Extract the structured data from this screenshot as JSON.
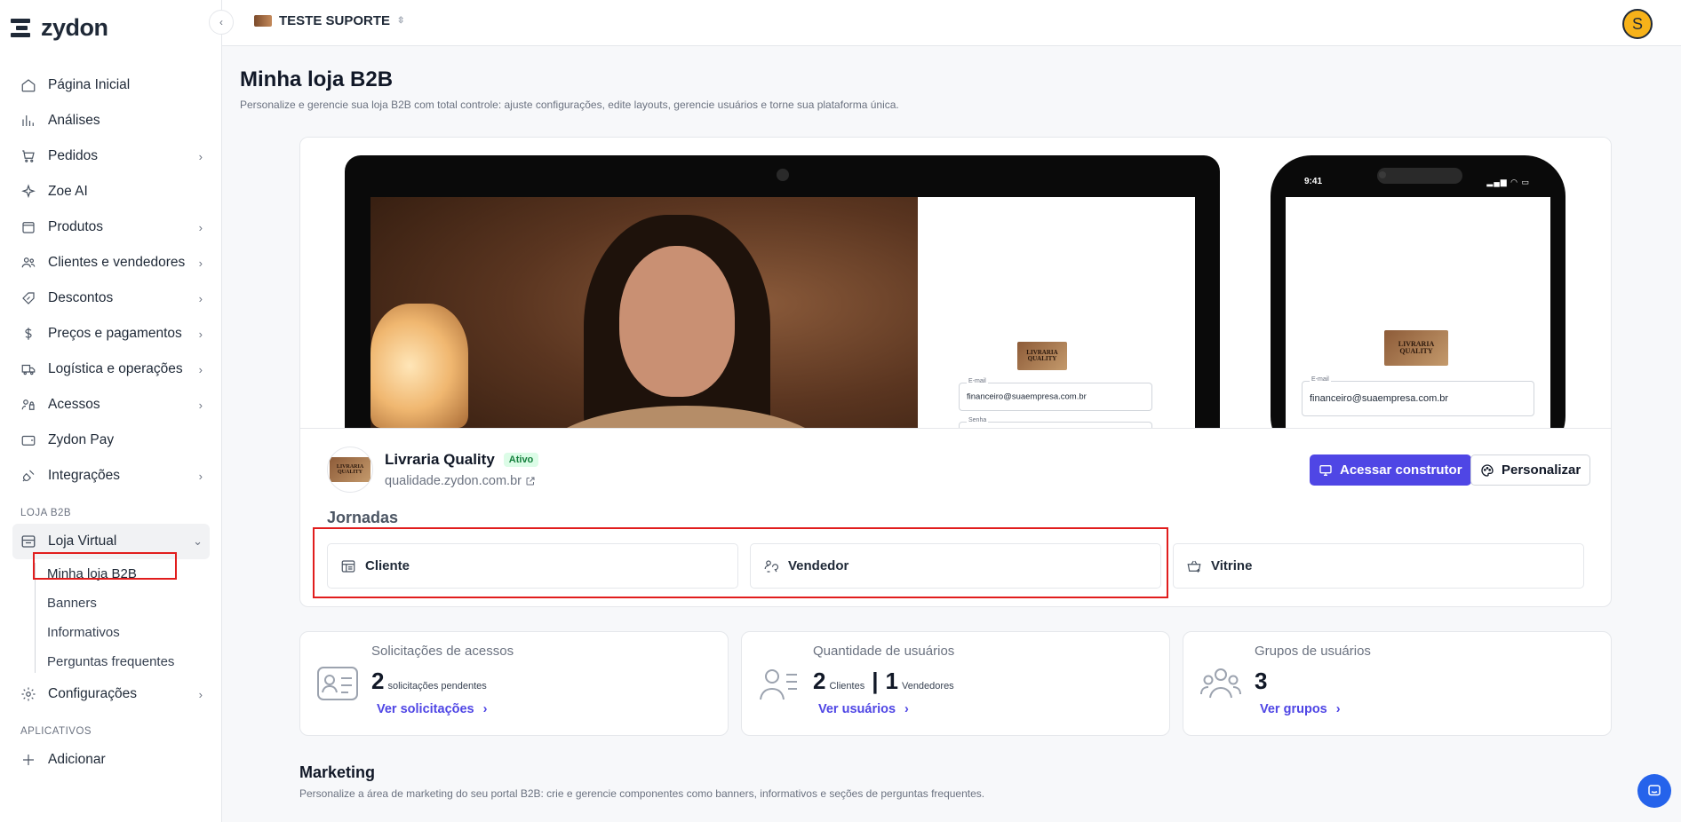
{
  "brand": {
    "name": "zydon"
  },
  "sidebar": {
    "items": [
      {
        "label": "Página Inicial",
        "icon": "home-icon"
      },
      {
        "label": "Análises",
        "icon": "chart-bars-icon"
      },
      {
        "label": "Pedidos",
        "icon": "cart-icon"
      },
      {
        "label": "Zoe AI",
        "icon": "sparkle-icon"
      },
      {
        "label": "Produtos",
        "icon": "box-icon"
      },
      {
        "label": "Clientes e vendedores",
        "icon": "users-icon"
      },
      {
        "label": "Descontos",
        "icon": "percent-tag-icon"
      },
      {
        "label": "Preços e pagamentos",
        "icon": "dollar-icon"
      },
      {
        "label": "Logística e operações",
        "icon": "truck-icon"
      },
      {
        "label": "Acessos",
        "icon": "access-icon"
      },
      {
        "label": "Zydon Pay",
        "icon": "wallet-icon"
      },
      {
        "label": "Integrações",
        "icon": "plug-icon"
      }
    ],
    "section_b2b": "LOJA B2B",
    "loja_virtual": {
      "label": "Loja Virtual",
      "icon": "storefront-icon"
    },
    "subitems": [
      "Minha loja B2B",
      "Banners",
      "Informativos",
      "Perguntas frequentes"
    ],
    "configuracoes": {
      "label": "Configurações",
      "icon": "gear-icon"
    },
    "section_apps": "APLICATIVOS",
    "add": {
      "label": "Adicionar",
      "icon": "plus-icon"
    }
  },
  "topbar": {
    "store": "TESTE SUPORTE",
    "avatar_initial": "S"
  },
  "page": {
    "title": "Minha loja B2B",
    "subtitle": "Personalize e gerencie sua loja B2B com total controle: ajuste configurações, edite layouts, gerencie usuários e torne sua plataforma única."
  },
  "preview": {
    "laptop": {
      "email_label": "E-mail",
      "email_value": "financeiro@suaempresa.com.br",
      "password_label": "Senha"
    },
    "phone": {
      "time": "9:41",
      "email_label": "E-mail",
      "email_value": "financeiro@suaempresa.com.br"
    },
    "logo_text": "LIVRARIA QUALITY"
  },
  "store": {
    "name": "Livraria Quality",
    "status": "Ativo",
    "url": "qualidade.zydon.com.br",
    "builder_button": "Acessar construtor",
    "customize_button": "Personalizar"
  },
  "journeys": {
    "title": "Jornadas",
    "items": [
      {
        "label": "Cliente",
        "icon": "table-icon"
      },
      {
        "label": "Vendedor",
        "icon": "seller-icon"
      },
      {
        "label": "Vitrine",
        "icon": "basket-icon"
      }
    ]
  },
  "stats": [
    {
      "label": "Solicitações de acessos",
      "value": "2",
      "unit": "solicitações pendentes",
      "link": "Ver solicitações"
    },
    {
      "label": "Quantidade de usuários",
      "value": "2",
      "unit": "Clientes",
      "sep": "|",
      "value2": "1",
      "unit2": "Vendedores",
      "link": "Ver usuários"
    },
    {
      "label": "Grupos de usuários",
      "value": "3",
      "link": "Ver grupos"
    }
  ],
  "marketing": {
    "title": "Marketing",
    "subtitle": "Personalize a área de marketing do seu portal B2B: crie e gerencie componentes como banners, informativos e seções de perguntas frequentes."
  },
  "colors": {
    "accent": "#4f46e5",
    "highlight_box": "#e11d1d",
    "active_badge": "#15803d"
  }
}
